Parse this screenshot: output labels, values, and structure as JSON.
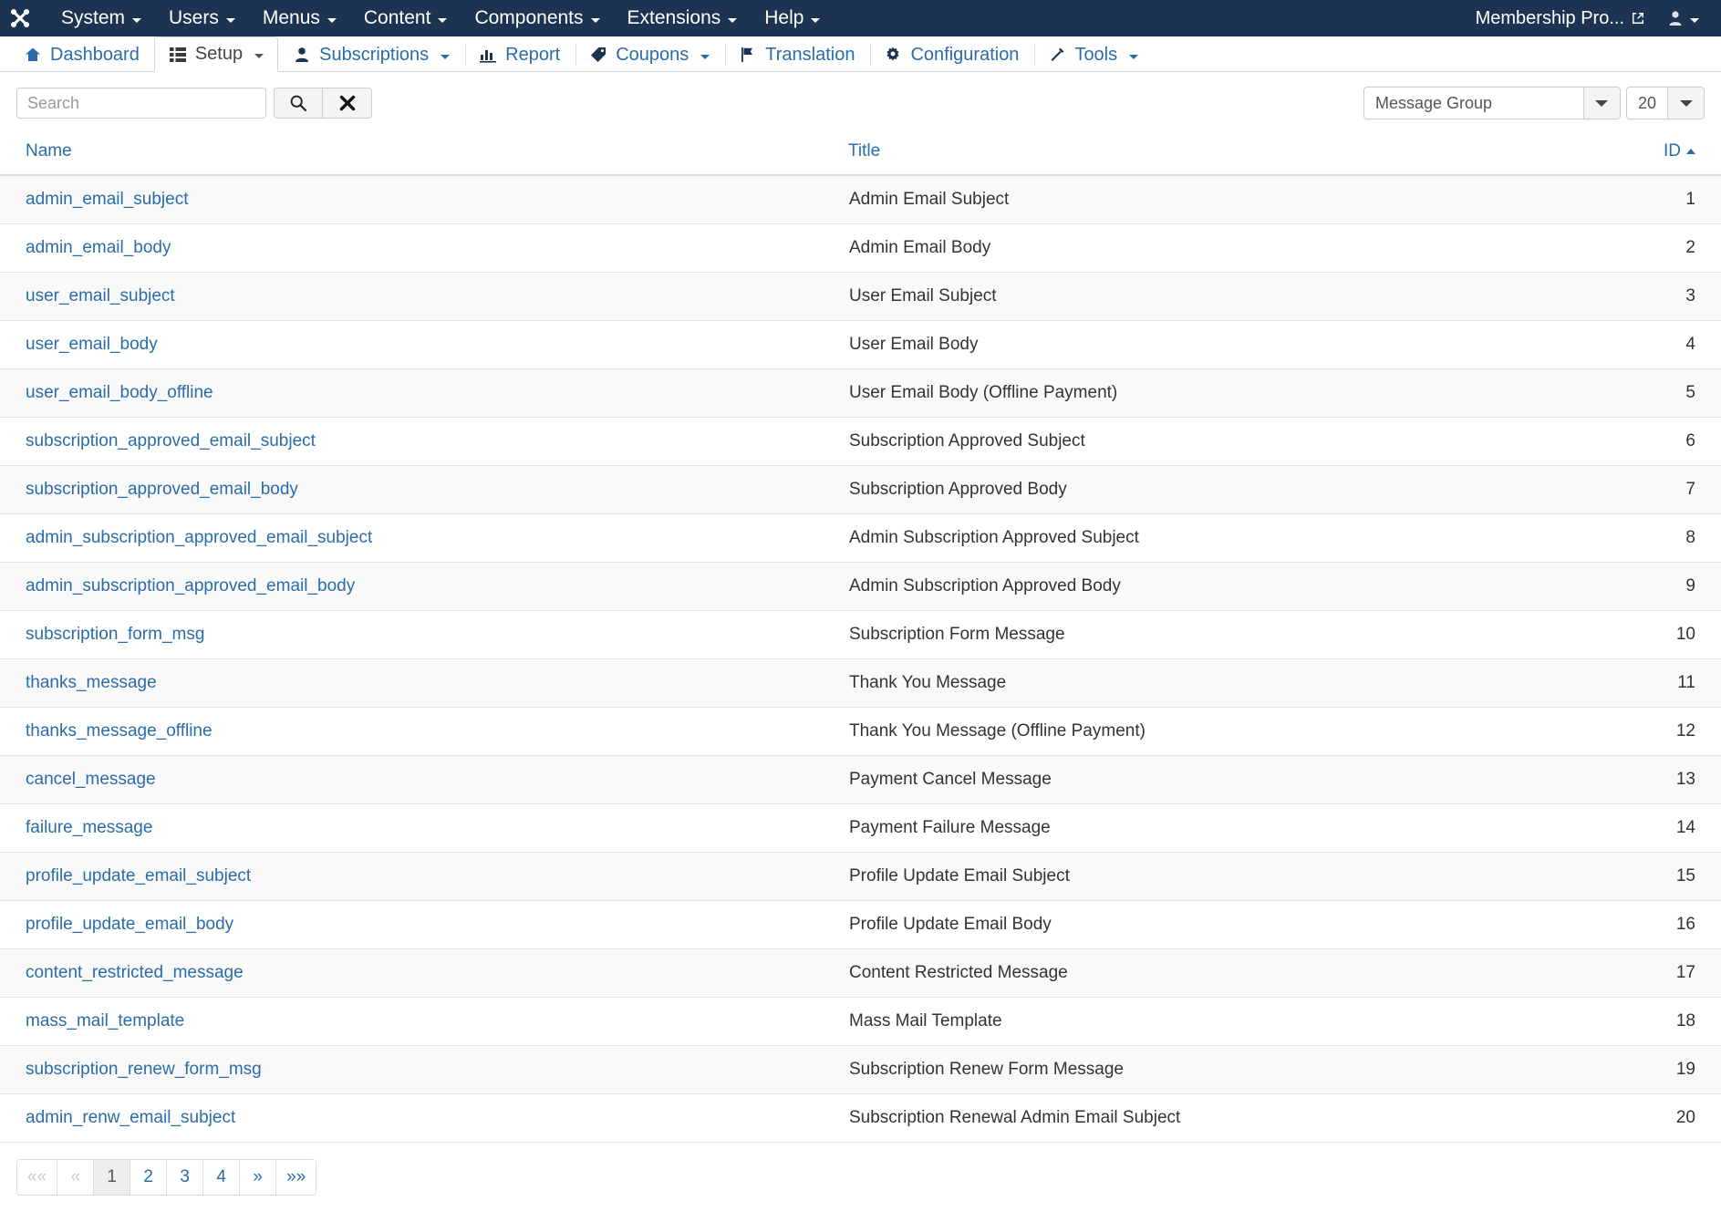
{
  "topbar": {
    "logo_icon": "joomla-logo-icon",
    "menus": [
      {
        "label": "System",
        "has_dropdown": true
      },
      {
        "label": "Users",
        "has_dropdown": true
      },
      {
        "label": "Menus",
        "has_dropdown": true
      },
      {
        "label": "Content",
        "has_dropdown": true
      },
      {
        "label": "Components",
        "has_dropdown": true
      },
      {
        "label": "Extensions",
        "has_dropdown": true
      },
      {
        "label": "Help",
        "has_dropdown": true
      }
    ],
    "site_link": "Membership Pro...",
    "site_link_icon": "external-link-icon",
    "user_icon": "user-avatar-icon"
  },
  "subnav": {
    "items": [
      {
        "label": "Dashboard",
        "icon": "home-icon",
        "has_dropdown": false,
        "active": false
      },
      {
        "label": "Setup",
        "icon": "list-grid-icon",
        "has_dropdown": true,
        "active": true
      },
      {
        "label": "Subscriptions",
        "icon": "user-icon",
        "has_dropdown": true,
        "active": false
      },
      {
        "label": "Report",
        "icon": "bar-chart-icon",
        "has_dropdown": false,
        "active": false
      },
      {
        "label": "Coupons",
        "icon": "tag-icon",
        "has_dropdown": true,
        "active": false
      },
      {
        "label": "Translation",
        "icon": "flag-icon",
        "has_dropdown": false,
        "active": false
      },
      {
        "label": "Configuration",
        "icon": "gear-icon",
        "has_dropdown": false,
        "active": false
      },
      {
        "label": "Tools",
        "icon": "wrench-icon",
        "has_dropdown": true,
        "active": false
      }
    ]
  },
  "filters": {
    "search_value": "",
    "search_placeholder": "Search",
    "search_button_icon": "magnifier-icon",
    "clear_button_icon": "close-x-icon",
    "group_select_value": "Message Group",
    "limit_select_value": "20"
  },
  "table": {
    "columns": [
      {
        "key": "name",
        "label": "Name",
        "sorted": false
      },
      {
        "key": "title",
        "label": "Title",
        "sorted": false
      },
      {
        "key": "id",
        "label": "ID",
        "sorted": true,
        "sort_direction": "asc"
      }
    ],
    "rows": [
      {
        "name": "admin_email_subject",
        "title": "Admin Email Subject",
        "id": "1"
      },
      {
        "name": "admin_email_body",
        "title": "Admin Email Body",
        "id": "2"
      },
      {
        "name": "user_email_subject",
        "title": "User Email Subject",
        "id": "3"
      },
      {
        "name": "user_email_body",
        "title": "User Email Body",
        "id": "4"
      },
      {
        "name": "user_email_body_offline",
        "title": "User Email Body (Offline Payment)",
        "id": "5"
      },
      {
        "name": "subscription_approved_email_subject",
        "title": "Subscription Approved Subject",
        "id": "6"
      },
      {
        "name": "subscription_approved_email_body",
        "title": "Subscription Approved Body",
        "id": "7"
      },
      {
        "name": "admin_subscription_approved_email_subject",
        "title": "Admin Subscription Approved Subject",
        "id": "8"
      },
      {
        "name": "admin_subscription_approved_email_body",
        "title": "Admin Subscription Approved Body",
        "id": "9"
      },
      {
        "name": "subscription_form_msg",
        "title": "Subscription Form Message",
        "id": "10"
      },
      {
        "name": "thanks_message",
        "title": "Thank You Message",
        "id": "11"
      },
      {
        "name": "thanks_message_offline",
        "title": "Thank You Message (Offline Payment)",
        "id": "12"
      },
      {
        "name": "cancel_message",
        "title": "Payment Cancel Message",
        "id": "13"
      },
      {
        "name": "failure_message",
        "title": "Payment Failure Message",
        "id": "14"
      },
      {
        "name": "profile_update_email_subject",
        "title": "Profile Update Email Subject",
        "id": "15"
      },
      {
        "name": "profile_update_email_body",
        "title": "Profile Update Email Body",
        "id": "16"
      },
      {
        "name": "content_restricted_message",
        "title": "Content Restricted Message",
        "id": "17"
      },
      {
        "name": "mass_mail_template",
        "title": "Mass Mail Template",
        "id": "18"
      },
      {
        "name": "subscription_renew_form_msg",
        "title": "Subscription Renew Form Message",
        "id": "19"
      },
      {
        "name": "admin_renw_email_subject",
        "title": "Subscription Renewal Admin Email Subject",
        "id": "20"
      }
    ]
  },
  "pagination": {
    "items": [
      {
        "label": "««",
        "name": "first-page-button",
        "state": "disabled",
        "icon": "first-page-icon"
      },
      {
        "label": "«",
        "name": "prev-page-button",
        "state": "disabled",
        "icon": "prev-page-icon"
      },
      {
        "label": "1",
        "name": "page-1-button",
        "state": "active",
        "icon": ""
      },
      {
        "label": "2",
        "name": "page-2-button",
        "state": "normal",
        "icon": ""
      },
      {
        "label": "3",
        "name": "page-3-button",
        "state": "normal",
        "icon": ""
      },
      {
        "label": "4",
        "name": "page-4-button",
        "state": "normal",
        "icon": ""
      },
      {
        "label": "»",
        "name": "next-page-button",
        "state": "normal",
        "icon": "next-page-icon"
      },
      {
        "label": "»»",
        "name": "last-page-button",
        "state": "normal",
        "icon": "last-page-icon"
      }
    ]
  },
  "colors": {
    "topbar_bg": "#1c3352",
    "link_blue": "#2a6ca9",
    "icon_navy": "#1c3352",
    "row_stripe": "#f9f9f9",
    "border": "#dddddd"
  }
}
